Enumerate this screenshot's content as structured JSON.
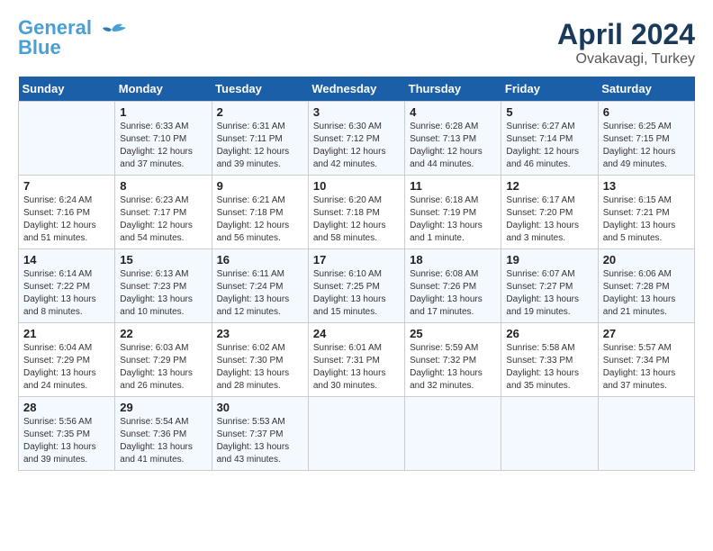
{
  "logo": {
    "line1": "General",
    "line2": "Blue"
  },
  "title": "April 2024",
  "location": "Ovakavagi, Turkey",
  "weekdays": [
    "Sunday",
    "Monday",
    "Tuesday",
    "Wednesday",
    "Thursday",
    "Friday",
    "Saturday"
  ],
  "weeks": [
    [
      {
        "num": "",
        "info": ""
      },
      {
        "num": "1",
        "info": "Sunrise: 6:33 AM\nSunset: 7:10 PM\nDaylight: 12 hours\nand 37 minutes."
      },
      {
        "num": "2",
        "info": "Sunrise: 6:31 AM\nSunset: 7:11 PM\nDaylight: 12 hours\nand 39 minutes."
      },
      {
        "num": "3",
        "info": "Sunrise: 6:30 AM\nSunset: 7:12 PM\nDaylight: 12 hours\nand 42 minutes."
      },
      {
        "num": "4",
        "info": "Sunrise: 6:28 AM\nSunset: 7:13 PM\nDaylight: 12 hours\nand 44 minutes."
      },
      {
        "num": "5",
        "info": "Sunrise: 6:27 AM\nSunset: 7:14 PM\nDaylight: 12 hours\nand 46 minutes."
      },
      {
        "num": "6",
        "info": "Sunrise: 6:25 AM\nSunset: 7:15 PM\nDaylight: 12 hours\nand 49 minutes."
      }
    ],
    [
      {
        "num": "7",
        "info": "Sunrise: 6:24 AM\nSunset: 7:16 PM\nDaylight: 12 hours\nand 51 minutes."
      },
      {
        "num": "8",
        "info": "Sunrise: 6:23 AM\nSunset: 7:17 PM\nDaylight: 12 hours\nand 54 minutes."
      },
      {
        "num": "9",
        "info": "Sunrise: 6:21 AM\nSunset: 7:18 PM\nDaylight: 12 hours\nand 56 minutes."
      },
      {
        "num": "10",
        "info": "Sunrise: 6:20 AM\nSunset: 7:18 PM\nDaylight: 12 hours\nand 58 minutes."
      },
      {
        "num": "11",
        "info": "Sunrise: 6:18 AM\nSunset: 7:19 PM\nDaylight: 13 hours\nand 1 minute."
      },
      {
        "num": "12",
        "info": "Sunrise: 6:17 AM\nSunset: 7:20 PM\nDaylight: 13 hours\nand 3 minutes."
      },
      {
        "num": "13",
        "info": "Sunrise: 6:15 AM\nSunset: 7:21 PM\nDaylight: 13 hours\nand 5 minutes."
      }
    ],
    [
      {
        "num": "14",
        "info": "Sunrise: 6:14 AM\nSunset: 7:22 PM\nDaylight: 13 hours\nand 8 minutes."
      },
      {
        "num": "15",
        "info": "Sunrise: 6:13 AM\nSunset: 7:23 PM\nDaylight: 13 hours\nand 10 minutes."
      },
      {
        "num": "16",
        "info": "Sunrise: 6:11 AM\nSunset: 7:24 PM\nDaylight: 13 hours\nand 12 minutes."
      },
      {
        "num": "17",
        "info": "Sunrise: 6:10 AM\nSunset: 7:25 PM\nDaylight: 13 hours\nand 15 minutes."
      },
      {
        "num": "18",
        "info": "Sunrise: 6:08 AM\nSunset: 7:26 PM\nDaylight: 13 hours\nand 17 minutes."
      },
      {
        "num": "19",
        "info": "Sunrise: 6:07 AM\nSunset: 7:27 PM\nDaylight: 13 hours\nand 19 minutes."
      },
      {
        "num": "20",
        "info": "Sunrise: 6:06 AM\nSunset: 7:28 PM\nDaylight: 13 hours\nand 21 minutes."
      }
    ],
    [
      {
        "num": "21",
        "info": "Sunrise: 6:04 AM\nSunset: 7:29 PM\nDaylight: 13 hours\nand 24 minutes."
      },
      {
        "num": "22",
        "info": "Sunrise: 6:03 AM\nSunset: 7:29 PM\nDaylight: 13 hours\nand 26 minutes."
      },
      {
        "num": "23",
        "info": "Sunrise: 6:02 AM\nSunset: 7:30 PM\nDaylight: 13 hours\nand 28 minutes."
      },
      {
        "num": "24",
        "info": "Sunrise: 6:01 AM\nSunset: 7:31 PM\nDaylight: 13 hours\nand 30 minutes."
      },
      {
        "num": "25",
        "info": "Sunrise: 5:59 AM\nSunset: 7:32 PM\nDaylight: 13 hours\nand 32 minutes."
      },
      {
        "num": "26",
        "info": "Sunrise: 5:58 AM\nSunset: 7:33 PM\nDaylight: 13 hours\nand 35 minutes."
      },
      {
        "num": "27",
        "info": "Sunrise: 5:57 AM\nSunset: 7:34 PM\nDaylight: 13 hours\nand 37 minutes."
      }
    ],
    [
      {
        "num": "28",
        "info": "Sunrise: 5:56 AM\nSunset: 7:35 PM\nDaylight: 13 hours\nand 39 minutes."
      },
      {
        "num": "29",
        "info": "Sunrise: 5:54 AM\nSunset: 7:36 PM\nDaylight: 13 hours\nand 41 minutes."
      },
      {
        "num": "30",
        "info": "Sunrise: 5:53 AM\nSunset: 7:37 PM\nDaylight: 13 hours\nand 43 minutes."
      },
      {
        "num": "",
        "info": ""
      },
      {
        "num": "",
        "info": ""
      },
      {
        "num": "",
        "info": ""
      },
      {
        "num": "",
        "info": ""
      }
    ]
  ]
}
